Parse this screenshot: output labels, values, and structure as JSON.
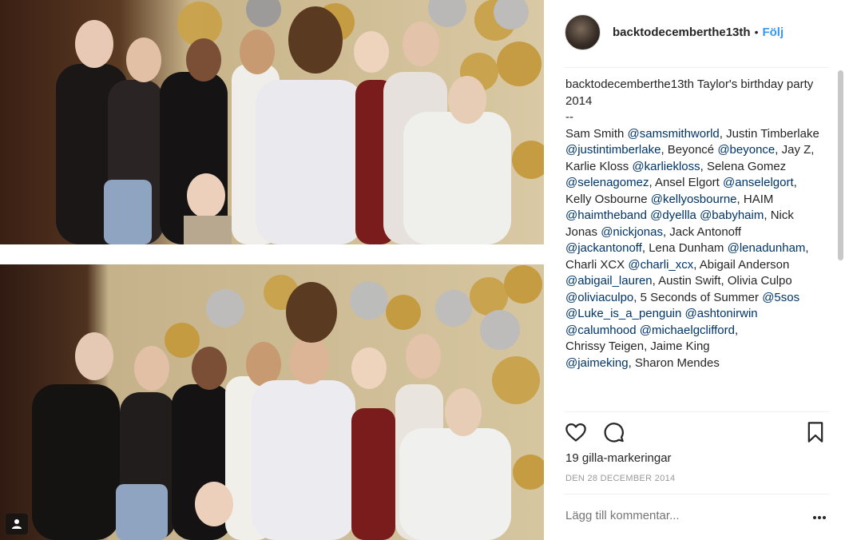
{
  "post": {
    "username": "backtodecemberthe13th",
    "separator": "•",
    "follow_label": "Följ",
    "caption": {
      "username": "backtodecemberthe13th",
      "segments": [
        {
          "t": " Taylor's birthday party 2014\n--\nSam Smith "
        },
        {
          "m": "@samsmithworld"
        },
        {
          "t": ", Justin Timberlake "
        },
        {
          "m": "@justintimberlake"
        },
        {
          "t": ", Beyoncé "
        },
        {
          "m": "@beyonce"
        },
        {
          "t": ", Jay Z, Karlie Kloss "
        },
        {
          "m": "@karliekloss"
        },
        {
          "t": ", Selena Gomez "
        },
        {
          "m": "@selenagomez"
        },
        {
          "t": ", Ansel Elgort "
        },
        {
          "m": "@anselelgort"
        },
        {
          "t": ", Kelly Osbourne "
        },
        {
          "m": "@kellyosbourne"
        },
        {
          "t": ", HAIM "
        },
        {
          "m": "@haimtheband"
        },
        {
          "t": " "
        },
        {
          "m": "@dyellla"
        },
        {
          "t": " "
        },
        {
          "m": "@babyhaim"
        },
        {
          "t": ", Nick Jonas "
        },
        {
          "m": "@nickjonas"
        },
        {
          "t": ", Jack Antonoff "
        },
        {
          "m": "@jackantonoff"
        },
        {
          "t": ", Lena Dunham "
        },
        {
          "m": "@lenadunham"
        },
        {
          "t": ", Charli XCX "
        },
        {
          "m": "@charli_xcx"
        },
        {
          "t": ", Abigail Anderson "
        },
        {
          "m": "@abigail_lauren"
        },
        {
          "t": ", Austin Swift, Olivia Culpo "
        },
        {
          "m": "@oliviaculpo"
        },
        {
          "t": ", 5 Seconds of Summer "
        },
        {
          "m": "@5sos"
        },
        {
          "t": " "
        },
        {
          "m": "@Luke_is_a_penguin"
        },
        {
          "t": " "
        },
        {
          "m": "@ashtonirwin"
        },
        {
          "t": " "
        },
        {
          "m": "@calumhood"
        },
        {
          "t": " "
        },
        {
          "m": "@michaelgclifford"
        },
        {
          "t": ",\nChrissy Teigen, Jaime King\n"
        },
        {
          "m": "@jaimeking"
        },
        {
          "t": ", Sharon Mendes"
        }
      ]
    },
    "likes": "19 gilla-markeringar",
    "date": "DEN 28 DECEMBER 2014",
    "comment_placeholder": "Lägg till kommentar...",
    "icons": {
      "like": "heart-icon",
      "comment": "comment-icon",
      "save": "bookmark-icon",
      "more": "more-icon",
      "user_tag": "user-tag-icon"
    },
    "colors": {
      "follow": "#3897f0",
      "mention": "#003569",
      "text": "#262626",
      "muted": "#999999"
    }
  }
}
